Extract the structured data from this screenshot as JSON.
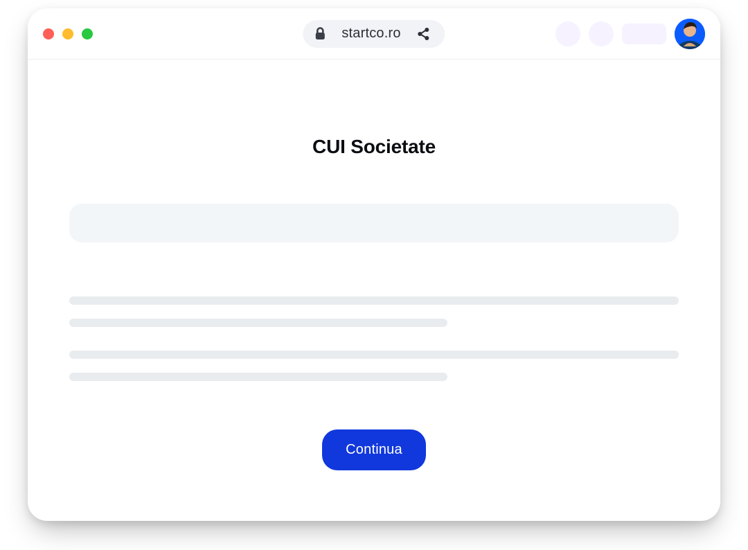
{
  "browser": {
    "url_display": "startco.ro"
  },
  "page": {
    "title": "CUI Societate",
    "cui_input_value": "",
    "continue_label": "Continua"
  },
  "icons": {
    "lock": "lock-icon",
    "share": "share-icon"
  },
  "colors": {
    "accent": "#1138dd",
    "avatar_bg": "#0b5cff"
  }
}
